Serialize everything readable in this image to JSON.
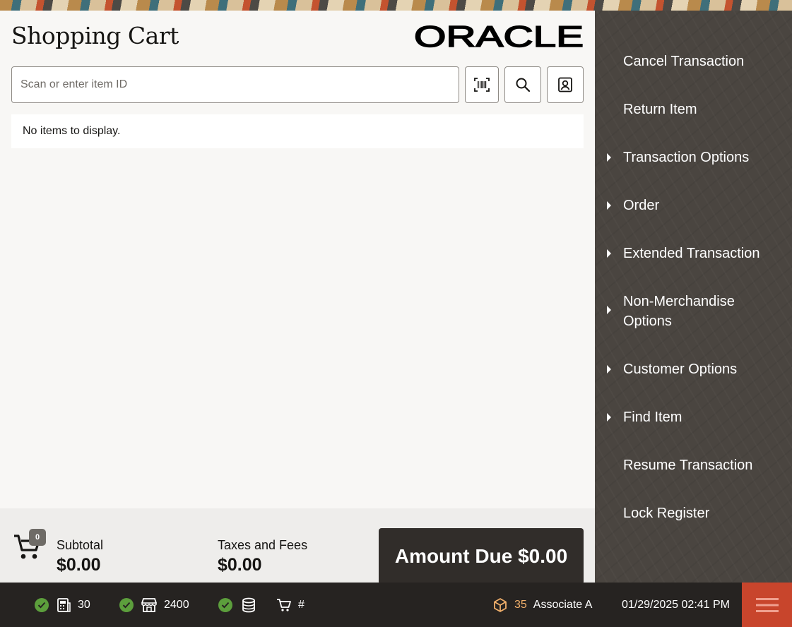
{
  "header": {
    "title": "Shopping Cart",
    "logo_text": "ORACLE"
  },
  "search": {
    "placeholder": "Scan or enter item ID"
  },
  "cart": {
    "empty_message": "No items to display.",
    "item_count": "0"
  },
  "totals": {
    "subtotal_label": "Subtotal",
    "subtotal_value": "$0.00",
    "taxes_label": "Taxes and Fees",
    "taxes_value": "$0.00",
    "amount_due": "Amount Due $0.00"
  },
  "sidebar": {
    "items": [
      {
        "label": "Cancel Transaction",
        "has_submenu": false
      },
      {
        "label": "Return Item",
        "has_submenu": false
      },
      {
        "label": "Transaction Options",
        "has_submenu": true
      },
      {
        "label": "Order",
        "has_submenu": true
      },
      {
        "label": "Extended Transaction",
        "has_submenu": true
      },
      {
        "label": "Non-Merchandise Options",
        "has_submenu": true
      },
      {
        "label": "Customer Options",
        "has_submenu": true
      },
      {
        "label": "Find Item",
        "has_submenu": true
      },
      {
        "label": "Resume Transaction",
        "has_submenu": false
      },
      {
        "label": "Lock Register",
        "has_submenu": false
      }
    ]
  },
  "status_bar": {
    "register": "30",
    "store": "2400",
    "transaction": "#",
    "associate_id": "35",
    "associate_name": "Associate A",
    "datetime": "01/29/2025 02:41 PM"
  },
  "colors": {
    "accent_red": "#c8452c",
    "status_ok": "#5c9e3c",
    "sidebar_bg": "#4a4540",
    "amount_due_bg": "#312d2a",
    "associate_icon": "#f2b06b"
  },
  "icons": [
    "barcode-scan-icon",
    "search-icon",
    "customer-lookup-icon",
    "shopping-cart-icon",
    "check-icon",
    "register-icon",
    "store-icon",
    "database-icon",
    "cart-small-icon",
    "box-icon",
    "hamburger-menu-icon",
    "chevron-right-icon"
  ]
}
